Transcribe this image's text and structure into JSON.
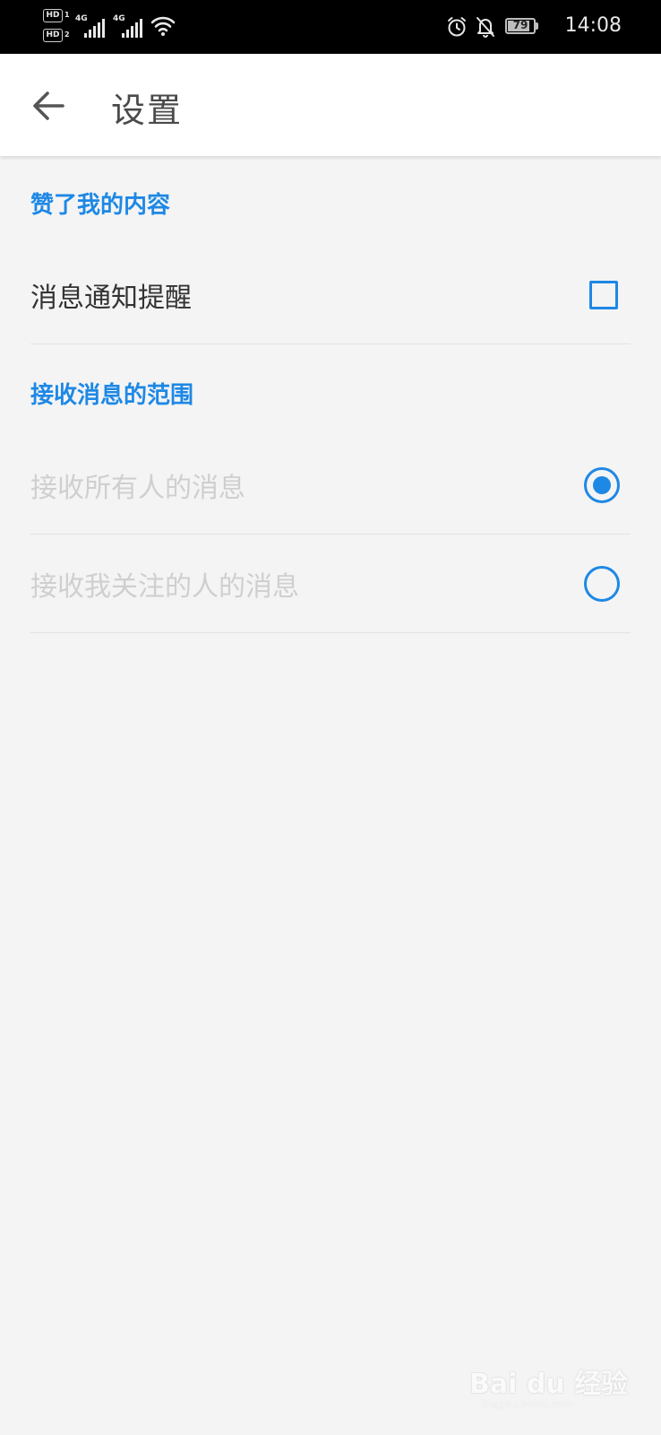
{
  "status_bar": {
    "hd1": "HD",
    "hd1_sub": "1",
    "hd2": "HD",
    "hd2_sub": "2",
    "net1": "4G",
    "net2": "4G",
    "battery_level": "79",
    "time": "14:08"
  },
  "toolbar": {
    "title": "设置"
  },
  "sections": {
    "likes": {
      "header": "赞了我的内容",
      "notify_label": "消息通知提醒",
      "notify_checked": false
    },
    "scope": {
      "header": "接收消息的范围",
      "options": [
        {
          "label": "接收所有人的消息",
          "selected": true
        },
        {
          "label": "接收我关注的人的消息",
          "selected": false
        }
      ]
    }
  },
  "watermark": {
    "text": "Bai du 经验",
    "url": "jingyan.baidu.com"
  },
  "colors": {
    "accent": "#1e88e5",
    "status_bar_bg": "#000000",
    "page_bg": "#f4f4f4"
  }
}
